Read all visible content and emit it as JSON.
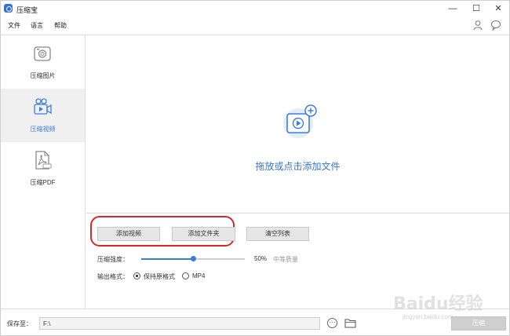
{
  "app": {
    "title": "压缩宝"
  },
  "window_controls": {
    "minimize": "—",
    "maximize": "☐",
    "close": "✕"
  },
  "menu": [
    "文件",
    "语言",
    "帮助"
  ],
  "sidebar": {
    "items": [
      {
        "label": "压缩图片",
        "icon": "camera-icon",
        "active": false
      },
      {
        "label": "压缩视频",
        "icon": "video-camera-icon",
        "active": true
      },
      {
        "label": "压缩PDF",
        "icon": "pdf-icon",
        "active": false
      }
    ]
  },
  "dropzone": {
    "text": "拖放或点击添加文件",
    "icon": "add-video-icon"
  },
  "buttons": {
    "add_video": "添加视频",
    "add_folder": "添加文件夹",
    "clear_list": "清空列表"
  },
  "compression": {
    "label": "压缩强度：",
    "value_percent": 50,
    "value_text": "50%",
    "quality_text": "中等质量"
  },
  "output_format": {
    "label": "输出格式：",
    "options": [
      {
        "label": "保持原格式",
        "selected": true
      },
      {
        "label": "MP4",
        "selected": false
      }
    ]
  },
  "footer": {
    "save_label": "保存至：",
    "path": "F:\\",
    "browse_symbol": "···",
    "compress_button": "压缩"
  },
  "watermark": {
    "text": "Baidu经验",
    "sub": "jingyan.baidu.com"
  },
  "colors": {
    "accent": "#3b7ddd",
    "highlight": "#d62828"
  }
}
